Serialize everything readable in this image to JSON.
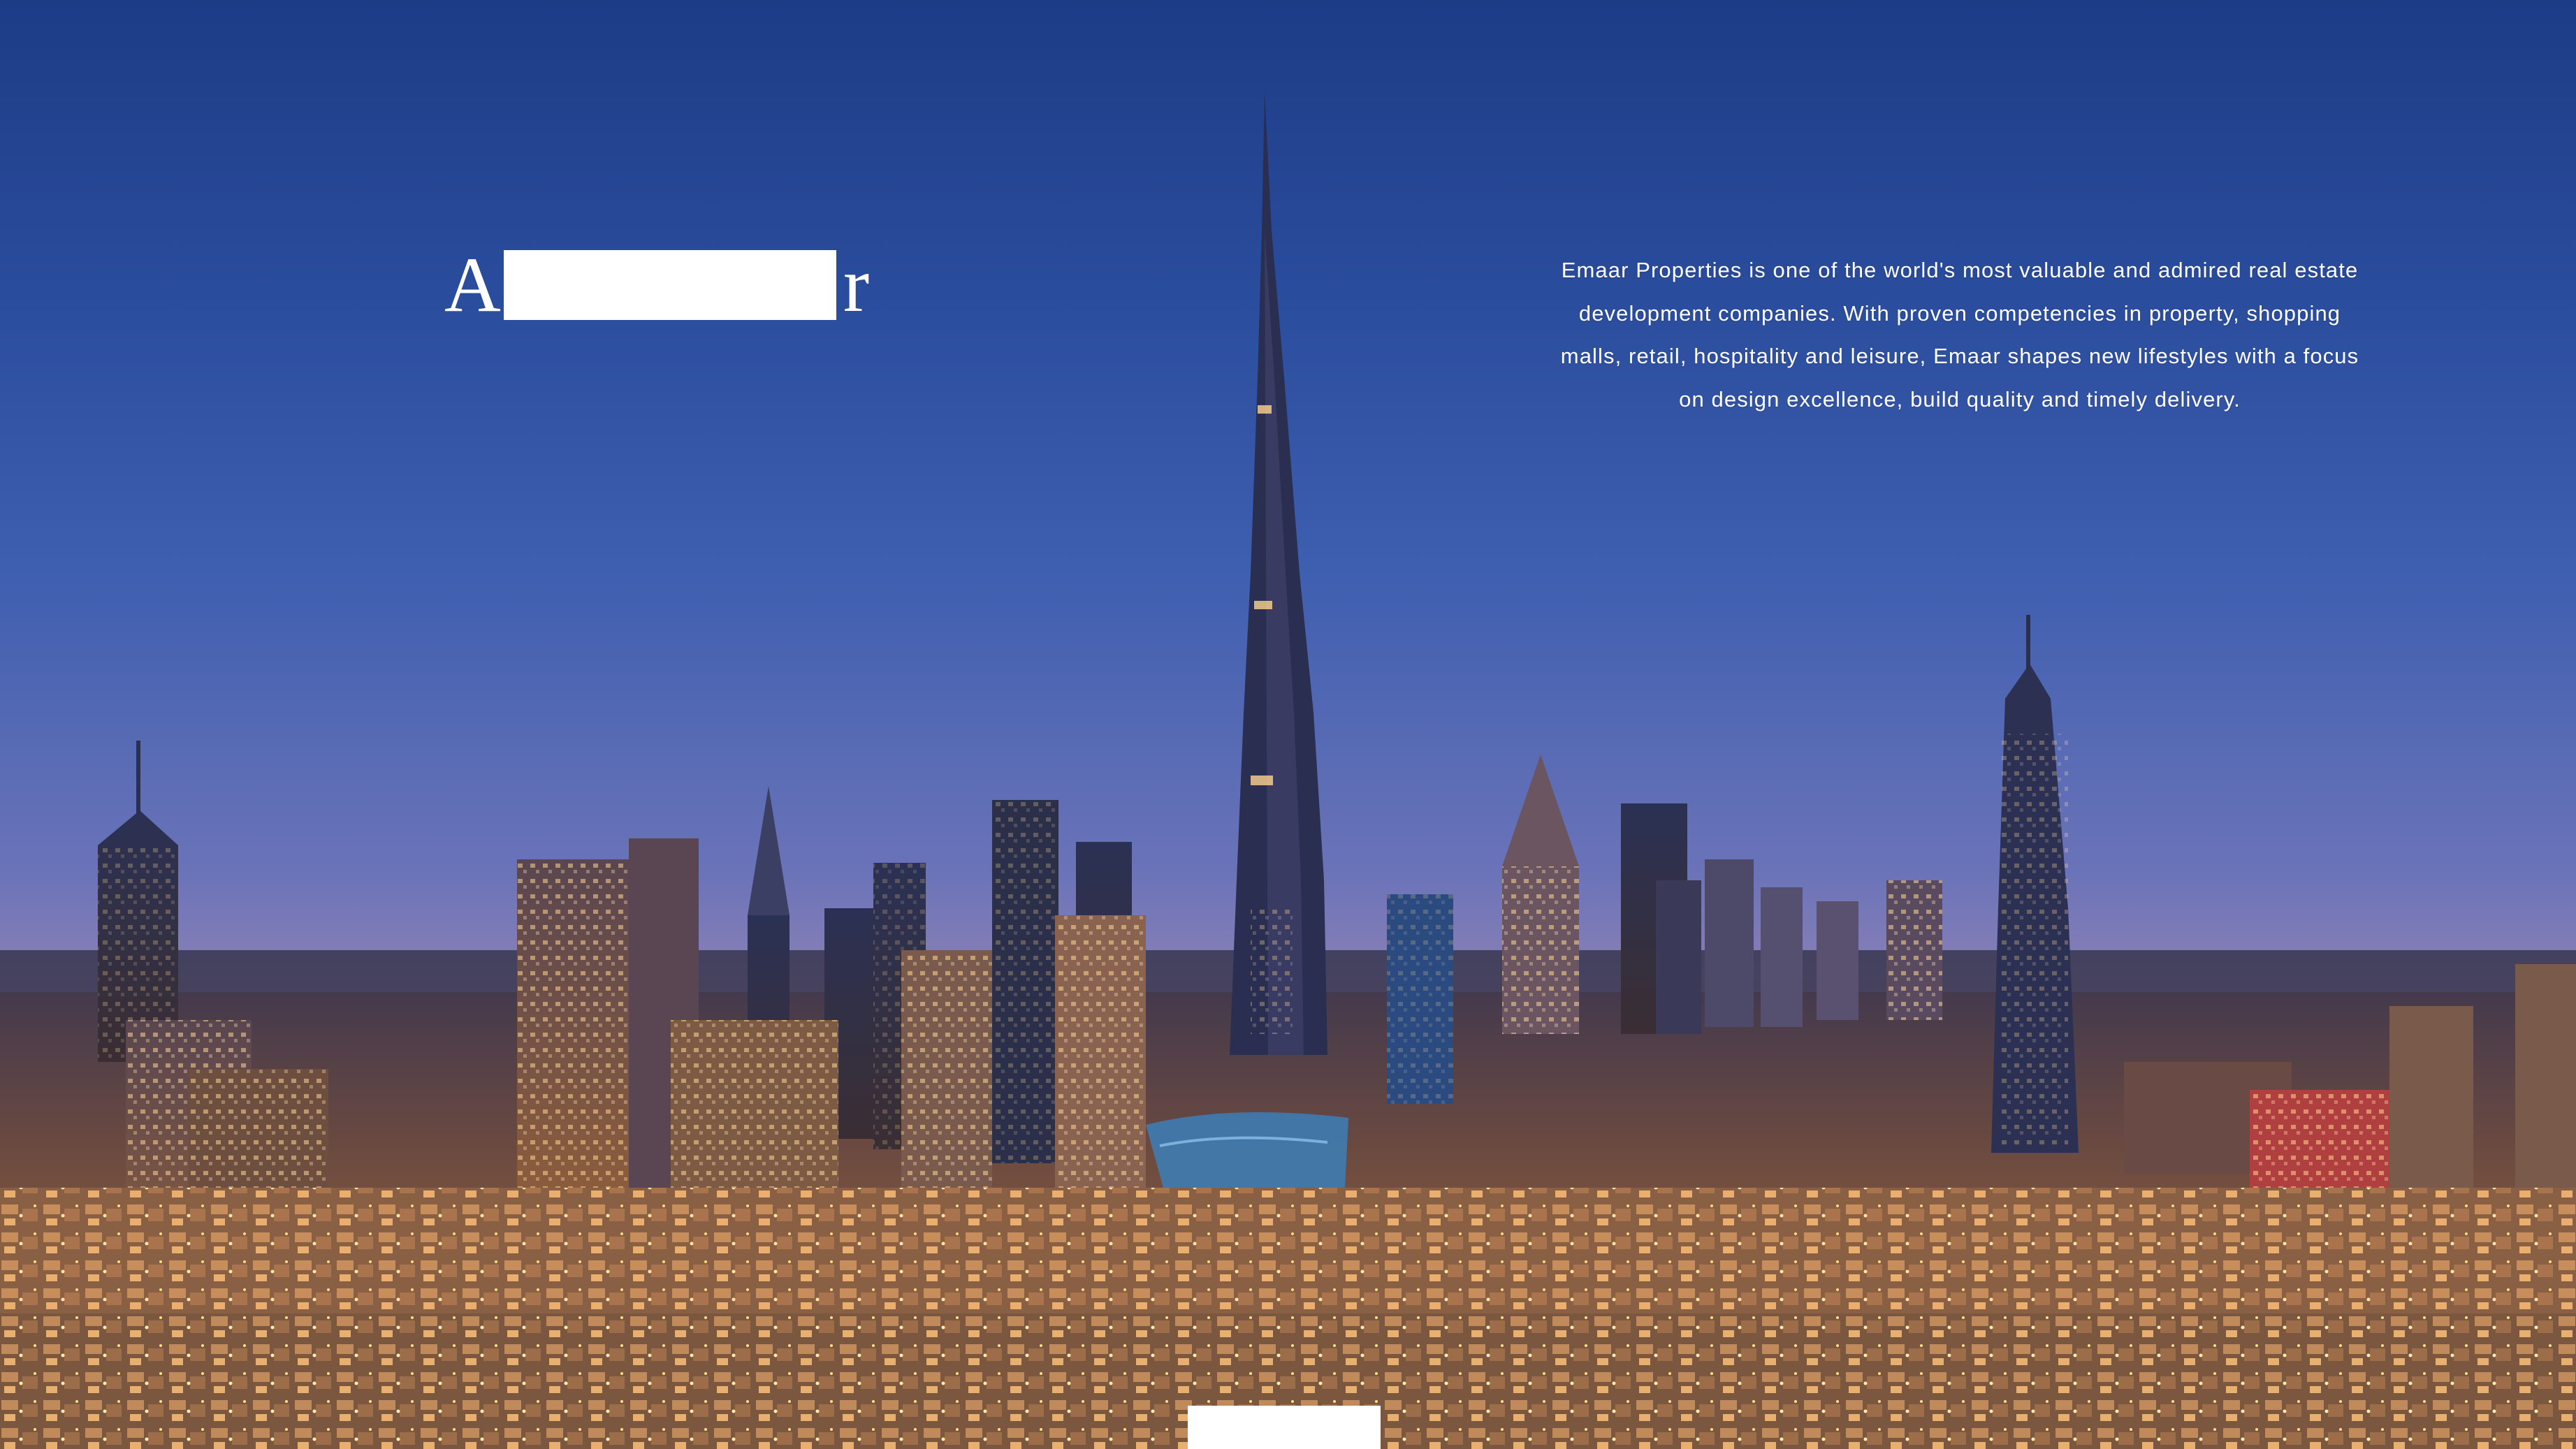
{
  "headline": {
    "first_char": "A",
    "last_char": "r"
  },
  "intro": {
    "text": "Emaar Properties is one of the world's most valuable and admired real estate development companies. With proven competencies in property, shopping malls, retail, hospitality and leisure, Emaar shapes new lifestyles with a focus on design excellence, build quality and timely delivery."
  },
  "colors": {
    "sky_top": "#1d3c86",
    "sky_horizon": "#d3a7b3",
    "text": "#ffffff",
    "city_lights": "#ffc36b"
  },
  "icons": {
    "skyline": "city-skyline-photo"
  }
}
